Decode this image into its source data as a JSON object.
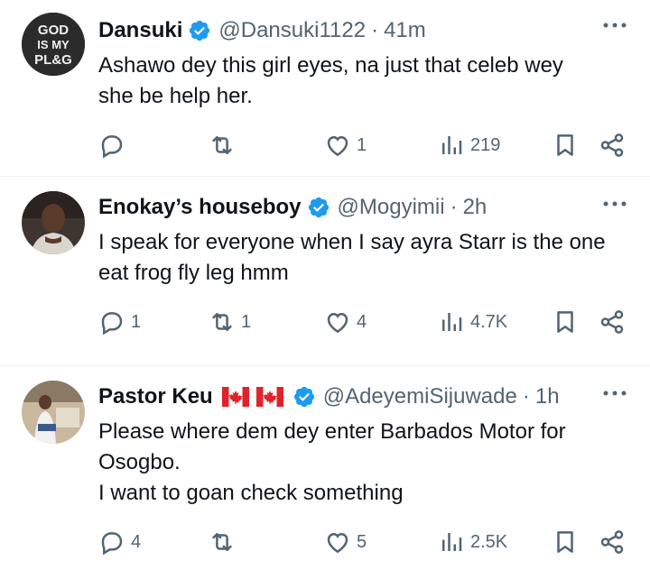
{
  "tweets": [
    {
      "name": "Dansuki",
      "handle": "@Dansuki1122",
      "time": "41m",
      "lines": [
        "Ashawo dey this girl eyes, na just that celeb wey",
        "she be help her."
      ],
      "replies": "",
      "retweets": "",
      "likes": "1",
      "views": "219",
      "avatar_text": [
        "GOD",
        "IS MY",
        "PL&G"
      ]
    },
    {
      "name": "Enokay’s houseboy",
      "handle": "@Mogyimii",
      "time": "2h",
      "lines": [
        "I speak for everyone when I say ayra Starr is the one",
        "eat frog fly leg hmm"
      ],
      "replies": "1",
      "retweets": "1",
      "likes": "4",
      "views": "4.7K"
    },
    {
      "name": "Pastor Keu",
      "handle": "@AdeyemiSijuwade",
      "time": "1h",
      "lines": [
        "Please where dem dey enter Barbados Motor for",
        "Osogbo.",
        "I want to goan check something"
      ],
      "replies": "4",
      "retweets": "",
      "likes": "5",
      "views": "2.5K",
      "flags": [
        "canada-flag-icon",
        "canada-flag-icon"
      ]
    }
  ],
  "separator": "·",
  "colors": {
    "verified": "#1d9bf0",
    "muted": "#536471",
    "text": "#0f1419",
    "flag_red": "#e0222a"
  }
}
